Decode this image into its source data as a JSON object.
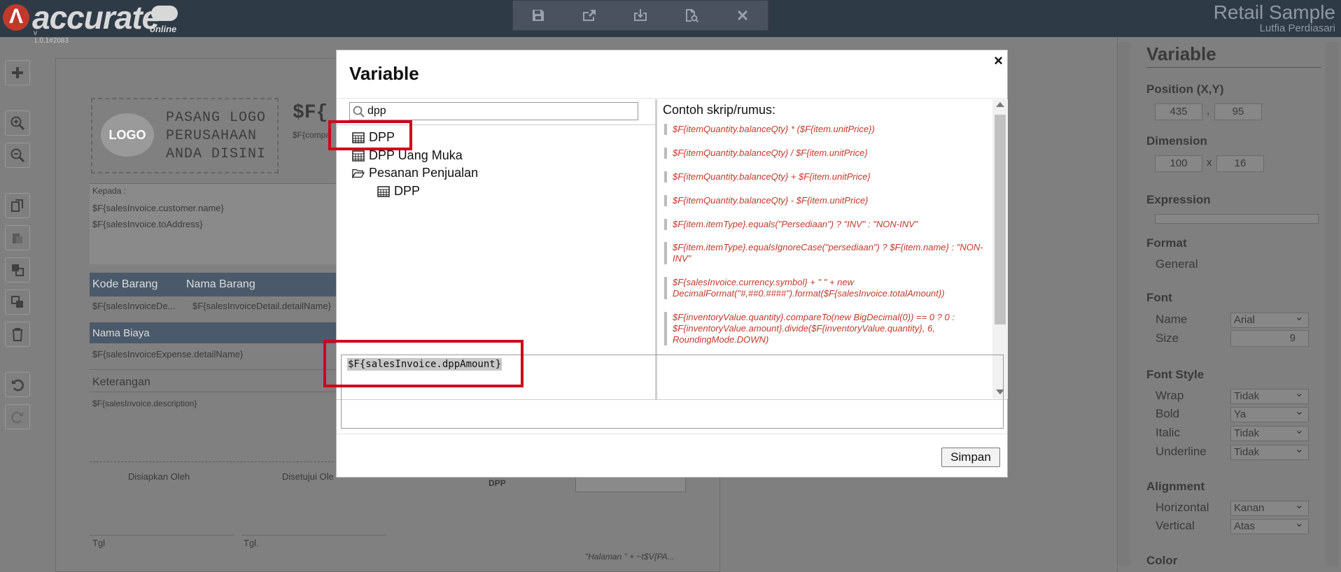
{
  "app": {
    "logo_text": "accurate",
    "logo_online": "online",
    "version": "v 1.0.1#2083",
    "company": "Retail Sample",
    "user": "Lutfia Perdiasari"
  },
  "toolbar": {
    "icons": [
      "save-icon",
      "export-icon",
      "import-icon",
      "preview-icon",
      "close-icon"
    ]
  },
  "document": {
    "logo_circle": "LOGO",
    "logo_lines": [
      "PASANG LOGO",
      "PERUSAHAAN",
      "ANDA DISINI"
    ],
    "company_field": "$F{",
    "company_sub": "$F{compa",
    "kepada": "Kepada :",
    "customer_name": "$F{salesInvoice.customer.name}",
    "to_address": "$F{salesInvoice.toAddress}",
    "col_kode": "Kode Barang",
    "col_nama": "Nama Barang",
    "row_kode": "$F{salesInvoiceDe...",
    "row_nama": "$F{salesInvoiceDetail.detailName}",
    "nama_biaya": "Nama Biaya",
    "expense_name": "$F{salesInvoiceExpense.detailName}",
    "keterangan": "Keterangan",
    "description": "$F{salesInvoice.description}",
    "disiapkan": "Disiapkan Oleh",
    "disetujui": "Disetujui Ole",
    "dpp_label": "DPP",
    "tgl1": "Tgl",
    "tgl2": "Tgl.",
    "footer": "\"Halaman \" + ~t$V{PA..."
  },
  "right_panel": {
    "title": "Variable",
    "position_label": "Position (X,Y)",
    "pos_x": "435",
    "pos_sep": ",",
    "pos_y": "95",
    "dimension_label": "Dimension",
    "dim_w": "100",
    "dim_sep": "x",
    "dim_h": "16",
    "expression_label": "Expression",
    "format_label": "Format",
    "format_value": "General",
    "font_label": "Font",
    "name_label": "Name",
    "name_value": "Arial",
    "size_label": "Size",
    "size_value": "9",
    "font_style_label": "Font Style",
    "wrap_label": "Wrap",
    "wrap_value": "Tidak",
    "bold_label": "Bold",
    "bold_value": "Ya",
    "italic_label": "Italic",
    "italic_value": "Tidak",
    "underline_label": "Underline",
    "underline_value": "Tidak",
    "alignment_label": "Alignment",
    "horizontal_label": "Horizontal",
    "horizontal_value": "Kanan",
    "vertical_label": "Vertical",
    "vertical_value": "Atas",
    "color_label": "Color"
  },
  "modal": {
    "title": "Variable",
    "close": "×",
    "search_value": "dpp",
    "tree": [
      {
        "label": "DPP",
        "icon": "calculator-icon"
      },
      {
        "label": "DPP Uang Muka",
        "icon": "calculator-icon"
      },
      {
        "label": "Pesanan Penjualan",
        "icon": "folder-open-icon"
      },
      {
        "label": "DPP",
        "icon": "calculator-icon"
      }
    ],
    "examples_title": "Contoh skrip/rumus:",
    "examples": [
      "$F{itemQuantity.balanceQty} * ($F{item.unitPrice})",
      "$F{itemQuantity.balanceQty} / $F{item.unitPrice}",
      "$F{itemQuantity.balanceQty} + $F{item.unitPrice}",
      "$F{itemQuantity.balanceQty} - $F{item.unitPrice}",
      "$F{item.itemType}.equals(\"Persediaan\") ? \"INV\" : \"NON-INV\"",
      "$F{item.itemType}.equalsIgnoreCase(\"persediaan\") ? $F{item.name} : \"NON-INV\"",
      "$F{salesInvoice.currency.symbol} + \" \" + new DecimalFormat(\"#,##0.####\").format($F{salesInvoice.totalAmount})",
      "$F{inventoryValue.quantity}.compareTo(new BigDecimal(0)) == 0 ? 0 : $F{inventoryValue.amount}.divide($F{inventoryValue.quantity}, 6, RoundingMode.DOWN)"
    ],
    "expression": "$F{salesInvoice.dppAmount}",
    "save_label": "Simpan"
  },
  "colors": {
    "topbar": "#2f3a47",
    "overlay": "#7f7f7f",
    "highlight": "#d0021b",
    "example_text": "#c0392b"
  }
}
